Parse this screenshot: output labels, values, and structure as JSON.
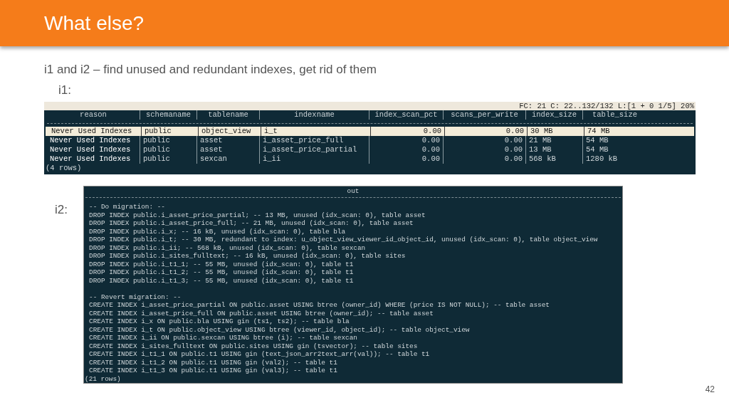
{
  "title": "What else?",
  "subtitle": "i1 and i2 – find unused and redundant indexes, get rid of them",
  "i1": {
    "label": "i1:",
    "status": "FC: 21 C: 22..132/132  L:[1 +  0  1/5]  20%",
    "columns": [
      "reason",
      "schemaname",
      "tablename",
      "indexname",
      "index_scan_pct",
      "scans_per_write",
      "index_size",
      "table_size"
    ],
    "rows": [
      {
        "selected": true,
        "cells": [
          "Never Used Indexes",
          "public",
          "object_view",
          "i_t",
          "0.00",
          "0.00",
          "30 MB",
          "74 MB"
        ]
      },
      {
        "selected": false,
        "cells": [
          "Never Used Indexes",
          "public",
          "asset",
          "i_asset_price_full",
          "0.00",
          "0.00",
          "21 MB",
          "54 MB"
        ]
      },
      {
        "selected": false,
        "cells": [
          "Never Used Indexes",
          "public",
          "asset",
          "i_asset_price_partial",
          "0.00",
          "0.00",
          "13 MB",
          "54 MB"
        ]
      },
      {
        "selected": false,
        "cells": [
          "Never Used Indexes",
          "public",
          "sexcan",
          "i_ii",
          "0.00",
          "0.00",
          "568 kB",
          "1280 kB"
        ]
      }
    ],
    "footer": "(4 rows)"
  },
  "i2": {
    "label": "i2:",
    "column": "out",
    "blocks": [
      {
        "lines": [
          "-- Do migration: --",
          "DROP INDEX public.i_asset_price_partial; -- 13 MB, unused (idx_scan: 0), table asset",
          "DROP INDEX public.i_asset_price_full; -- 21 MB, unused (idx_scan: 0), table asset",
          "DROP INDEX public.i_x; -- 16 kB, unused (idx_scan: 0), table bla",
          "DROP INDEX public.i_t; -- 30 MB, redundant to index: u_object_view_viewer_id_object_id, unused (idx_scan: 0), table object_view",
          "DROP INDEX public.i_ii; -- 568 kB, unused (idx_scan: 0), table sexcan",
          "DROP INDEX public.i_sites_fulltext; -- 16 kB, unused (idx_scan: 0), table sites",
          "DROP INDEX public.i_t1_1; -- 55 MB, unused (idx_scan: 0), table t1",
          "DROP INDEX public.i_t1_2; -- 55 MB, unused (idx_scan: 0), table t1",
          "DROP INDEX public.i_t1_3; -- 55 MB, unused (idx_scan: 0), table t1"
        ]
      },
      {
        "lines": [
          "-- Revert migration: --",
          "CREATE INDEX i_asset_price_partial ON public.asset USING btree (owner_id) WHERE (price IS NOT NULL); -- table asset",
          "CREATE INDEX i_asset_price_full ON public.asset USING btree (owner_id); -- table asset",
          "CREATE INDEX i_x ON public.bla USING gin (ts1, ts2); -- table bla",
          "CREATE INDEX i_t ON public.object_view USING btree (viewer_id, object_id); -- table object_view",
          "CREATE INDEX i_ii ON public.sexcan USING btree (i); -- table sexcan",
          "CREATE INDEX i_sites_fulltext ON public.sites USING gin (tsvector); -- table sites",
          "CREATE INDEX i_t1_1 ON public.t1 USING gin (text_json_arr2text_arr(val)); -- table t1",
          "CREATE INDEX i_t1_2 ON public.t1 USING gin (val2); -- table t1",
          "CREATE INDEX i_t1_3 ON public.t1 USING gin (val3); -- table t1"
        ]
      }
    ],
    "footer": "(21 rows)"
  },
  "page_number": "42"
}
